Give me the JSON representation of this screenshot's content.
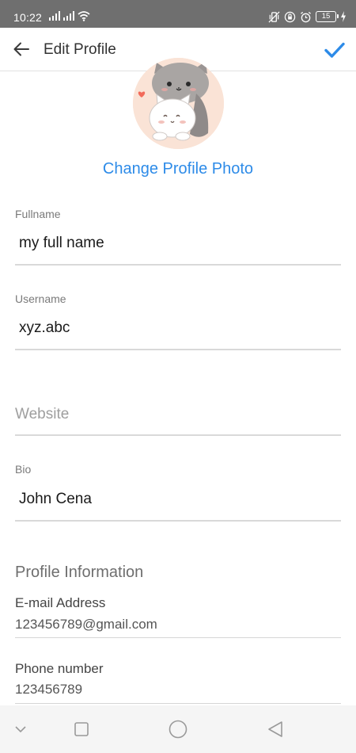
{
  "status_bar": {
    "time": "10:22",
    "battery_level": "15",
    "icons": [
      "signal-icon",
      "signal-icon",
      "wifi-icon",
      "vibrate-icon",
      "lock-rotation-icon",
      "alarm-icon",
      "battery-icon",
      "charging-icon"
    ]
  },
  "app_bar": {
    "title": "Edit Profile",
    "back_icon": "arrow-left-icon",
    "done_icon": "check-icon",
    "accent_color": "#2d8be8"
  },
  "profile": {
    "avatar": "cat-couple-avatar",
    "change_photo_label": "Change Profile Photo"
  },
  "form": {
    "fullname": {
      "label": "Fullname",
      "value": "my full name"
    },
    "username": {
      "label": "Username",
      "value": "xyz.abc"
    },
    "website": {
      "placeholder": "Website",
      "value": ""
    },
    "bio": {
      "label": "Bio",
      "value": "John Cena"
    }
  },
  "profile_info": {
    "title": "Profile Information",
    "email": {
      "label": "E-mail Address",
      "value": "123456789@gmail.com"
    },
    "phone": {
      "label": "Phone number",
      "value": "123456789"
    }
  },
  "nav_bar": {
    "icons": [
      "chevron-down-icon",
      "square-icon",
      "circle-icon",
      "triangle-back-icon"
    ]
  }
}
